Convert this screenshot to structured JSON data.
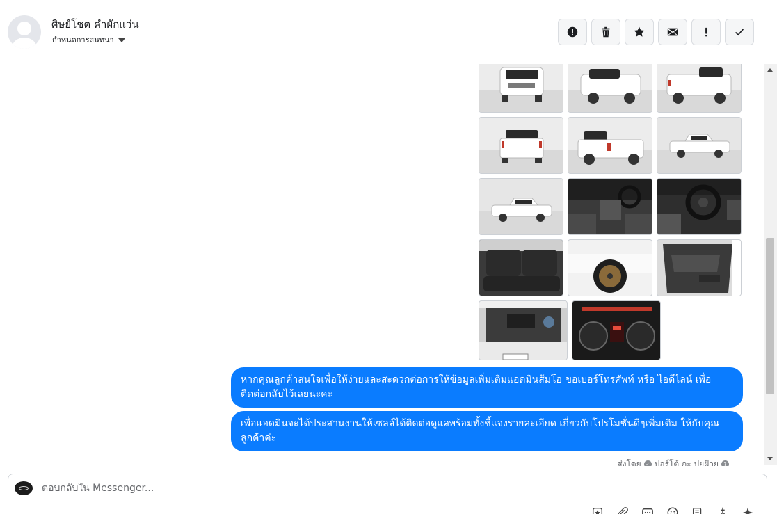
{
  "header": {
    "contact_name": "ศิษย์โชต คำผักแว่น",
    "assign_label": "กำหนดการสนทนา",
    "actions": [
      {
        "icon": "alert-circle-icon",
        "label": "Mark as spam"
      },
      {
        "icon": "trash-icon",
        "label": "Delete"
      },
      {
        "icon": "star-icon",
        "label": "Star"
      },
      {
        "icon": "envelope-icon",
        "label": "Mark as unread"
      },
      {
        "icon": "exclamation-icon",
        "label": "Follow up"
      },
      {
        "icon": "check-icon",
        "label": "Mark as done"
      }
    ]
  },
  "messages": [
    {
      "text": "หากคุณลูกค้าสนใจเพื่อให้ง่ายและสะดวกต่อการให้ข้อมูลเพิ่มเติมแอดมินส้มโอ ขอเบอร์โทรศัพท์ หรือ ไอดีไลน์ เพื่อติดต่อกลับไว้เลยนะคะ"
    },
    {
      "text": "เพื่อแอดมินจะได้ประสานงานให้เซลล์ได้ติดต่อดูแลพร้อมทั้งชี้แจงรายละเอียด เกี่ยวกับโปรโมชั่นดีๆเพิ่มเติม ให้กับคุณลูกค้าค่ะ"
    }
  ],
  "sent_by": {
    "prefix": "ส่งโดย",
    "name": "ปอร์โต้ กะ ปยฝ้าย"
  },
  "composer": {
    "placeholder": "ตอบกลับใน Messenger...",
    "tools": [
      "saved-reply-icon",
      "attach-icon",
      "more-icon",
      "emoji-icon",
      "template-icon",
      "pin-icon",
      "sparkle-icon"
    ]
  },
  "photos": [
    "white pickup front view",
    "white pickup front three-quarter view",
    "white pickup rear three-quarter view",
    "white pickup rear view",
    "white pickup rear three-quarter view",
    "white pickup side view",
    "white pickup side view",
    "dashboard interior",
    "steering wheel interior",
    "rear seats",
    "alloy wheel",
    "door panel",
    "engine bay",
    "instrument cluster"
  ],
  "colors": {
    "bubble": "#0a7cff",
    "bubble_text": "#ffffff",
    "border": "#dadde1"
  }
}
